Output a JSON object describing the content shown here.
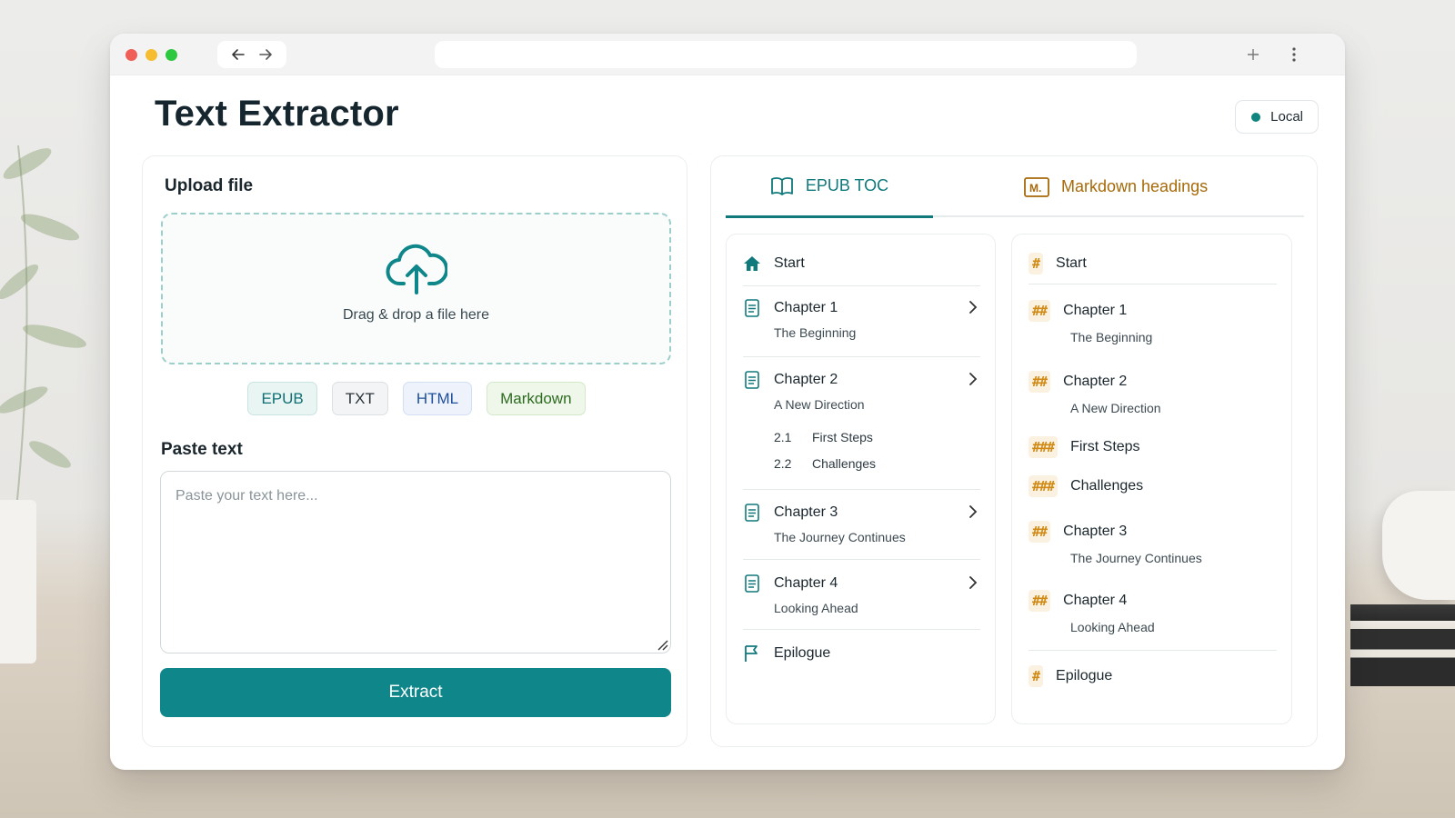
{
  "app": {
    "title": "Text Extractor",
    "status_badge": "Local",
    "accent": "#0f878a",
    "markdown_accent": "#d08a14"
  },
  "upload": {
    "label": "Upload file",
    "drop_text": "Drag & drop a file here",
    "formats": [
      "EPUB",
      "TXT",
      "HTML",
      "Markdown"
    ]
  },
  "paste": {
    "label": "Paste text",
    "placeholder": "Paste your text here...",
    "value": ""
  },
  "extract_button": "Extract",
  "tabs": [
    {
      "label": "EPUB TOC",
      "icon": "book-icon",
      "active": true
    },
    {
      "label": "Markdown headings",
      "icon": "markdown-icon",
      "active": false
    }
  ],
  "epub_toc": {
    "start": "Start",
    "chapters": [
      {
        "title": "Chapter 1",
        "subtitle": "The Beginning"
      },
      {
        "title": "Chapter 2",
        "subtitle": "A New Direction",
        "sections": [
          {
            "num": "2.1",
            "title": "First Steps"
          },
          {
            "num": "2.2",
            "title": "Challenges"
          }
        ]
      },
      {
        "title": "Chapter 3",
        "subtitle": "The Journey Continues"
      },
      {
        "title": "Chapter 4",
        "subtitle": "Looking Ahead"
      }
    ],
    "epilogue": "Epilogue"
  },
  "markdown_headings": [
    {
      "level": "#",
      "title": "Start"
    },
    {
      "level": "##",
      "title": "Chapter 1",
      "subtitle": "The Beginning"
    },
    {
      "level": "##",
      "title": "Chapter 2",
      "subtitle": "A New Direction"
    },
    {
      "level": "###",
      "title": "First Steps"
    },
    {
      "level": "###",
      "title": "Challenges"
    },
    {
      "level": "##",
      "title": "Chapter 3",
      "subtitle": "The Journey Continues"
    },
    {
      "level": "##",
      "title": "Chapter 4",
      "subtitle": "Looking Ahead"
    },
    {
      "level": "#",
      "title": "Epilogue"
    }
  ]
}
